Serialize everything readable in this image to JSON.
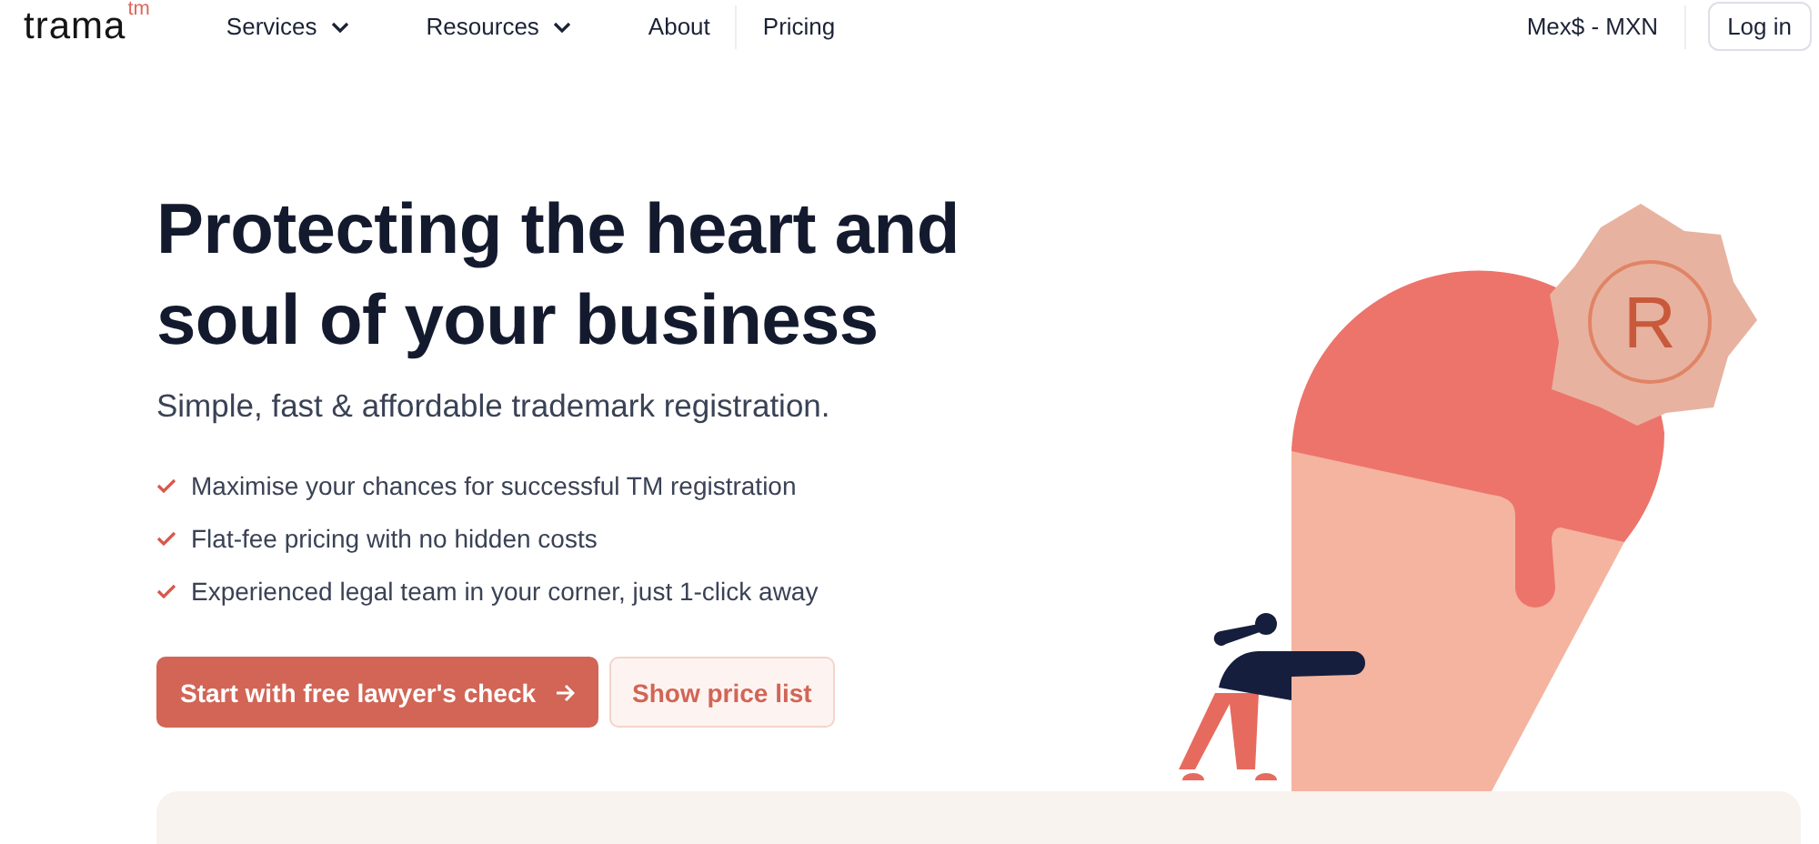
{
  "logo": {
    "name": "trama",
    "mark": "tm"
  },
  "nav": [
    {
      "label": "Services",
      "dropdown": true
    },
    {
      "label": "Resources",
      "dropdown": true
    },
    {
      "label": "About",
      "dropdown": false
    },
    {
      "label": "Pricing",
      "dropdown": false
    }
  ],
  "currency": "Mex$ - MXN",
  "login": "Log in",
  "hero": {
    "title_lines": [
      "Protecting the heart and",
      "soul of your business"
    ],
    "subtitle": "Simple, fast & affordable trademark registration.",
    "benefits": [
      "Maximise your chances for successful TM registration",
      "Flat-fee pricing with no hidden costs",
      "Experienced legal team in your corner, just 1-click away"
    ],
    "buttons": [
      {
        "label": "Start with free lawyer's check",
        "kind": "primary",
        "arrow": true
      },
      {
        "label": "Show price list",
        "kind": "secondary",
        "arrow": false
      }
    ],
    "seal_symbol": "R"
  }
}
